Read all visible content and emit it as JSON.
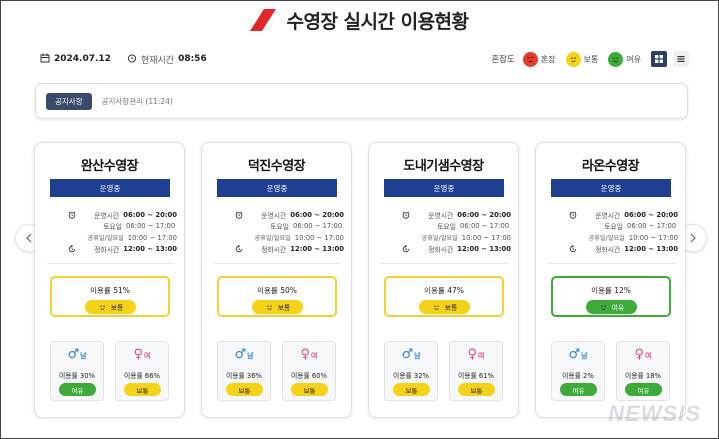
{
  "header": {
    "title": "수영장 실시간 이용현황",
    "date": "2024.07.12",
    "time_label": "현재시간",
    "time_value": "08:56"
  },
  "legend": {
    "title": "혼잡도",
    "items": [
      {
        "label": "혼잡",
        "color": "#e63c2e",
        "icon": "angry-face-icon"
      },
      {
        "label": "보통",
        "color": "#f5d21a",
        "icon": "neutral-face-icon"
      },
      {
        "label": "여유",
        "color": "#3dac3a",
        "icon": "happy-face-icon"
      }
    ]
  },
  "notice": {
    "badge": "공지사항",
    "text": "공지사항관리 (11:24)"
  },
  "pools": [
    {
      "name": "완산수영장",
      "status": "운영중",
      "hours": [
        {
          "label": "운영시간",
          "value": "06:00 ~ 20:00"
        },
        {
          "label": "토요일",
          "value": "06:00 ~ 17:00"
        },
        {
          "label": "공휴일/일요일",
          "value": "10:00 ~ 17:00"
        },
        {
          "label": "정화시간",
          "value": "12:00 ~ 13:00"
        }
      ],
      "usage_text": "이용률 51%",
      "usage_state": "보통",
      "male_label": "남",
      "male_usage": "이용률 30%",
      "male_state": "여유",
      "female_label": "여",
      "female_usage": "이용률 66%",
      "female_state": "보통"
    },
    {
      "name": "덕진수영장",
      "status": "운영중",
      "hours": [
        {
          "label": "운영시간",
          "value": "06:00 ~ 20:00"
        },
        {
          "label": "토요일",
          "value": "06:00 ~ 17:00"
        },
        {
          "label": "공휴일/일요일",
          "value": "10:00 ~ 17:00"
        },
        {
          "label": "정화시간",
          "value": "12:00 ~ 13:00"
        }
      ],
      "usage_text": "이용률 50%",
      "usage_state": "보통",
      "male_label": "남",
      "male_usage": "이용률 36%",
      "male_state": "보통",
      "female_label": "여",
      "female_usage": "이용률 60%",
      "female_state": "보통"
    },
    {
      "name": "도내기샘수영장",
      "status": "운영중",
      "hours": [
        {
          "label": "운영시간",
          "value": "06:00 ~ 20:00"
        },
        {
          "label": "토요일",
          "value": "06:00 ~ 17:00"
        },
        {
          "label": "공휴일/일요일",
          "value": "10:00 ~ 17:00"
        },
        {
          "label": "정화시간",
          "value": "12:00 ~ 13:00"
        }
      ],
      "usage_text": "이용률 47%",
      "usage_state": "보통",
      "male_label": "남",
      "male_usage": "이용률 32%",
      "male_state": "보통",
      "female_label": "여",
      "female_usage": "이용률 61%",
      "female_state": "보통"
    },
    {
      "name": "라온수영장",
      "status": "운영중",
      "hours": [
        {
          "label": "운영시간",
          "value": "06:00 ~ 20:00"
        },
        {
          "label": "토요일",
          "value": "06:00 ~ 17:00"
        },
        {
          "label": "공휴일/일요일",
          "value": "10:00 ~ 17:00"
        },
        {
          "label": "정화시간",
          "value": "12:00 ~ 13:00"
        }
      ],
      "usage_text": "이용률 12%",
      "usage_state": "여유",
      "male_label": "남",
      "male_usage": "이용률 2%",
      "male_state": "여유",
      "female_label": "여",
      "female_usage": "이용률 18%",
      "female_state": "여유"
    }
  ],
  "watermark": "NEWSIS",
  "colors": {
    "status_bar": "#1f3f91",
    "moderate": "#f5d21a",
    "relaxed": "#3dac3a",
    "busy": "#e63c2e"
  }
}
